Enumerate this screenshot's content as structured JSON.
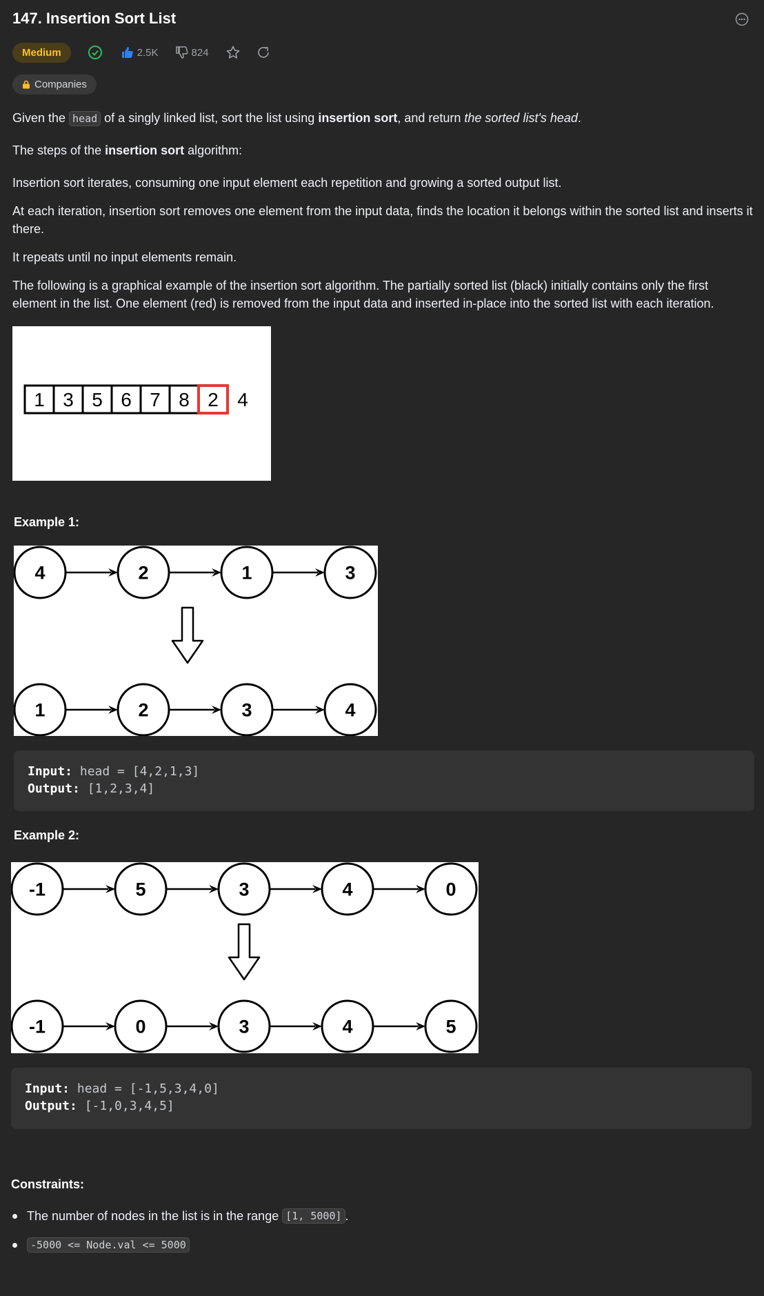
{
  "header": {
    "title": "147. Insertion Sort List",
    "difficulty": "Medium",
    "likes": "2.5K",
    "dislikes": "824",
    "companies_label": "Companies"
  },
  "description": {
    "p1": {
      "a": "Given the ",
      "code": "head",
      "b": " of a singly linked list, sort the list using ",
      "bold": "insertion sort",
      "c": ", and return ",
      "italic": "the sorted list's head",
      "d": "."
    },
    "p2": {
      "a": "The steps of the ",
      "bold": "insertion sort",
      "b": " algorithm:"
    },
    "p3": "Insertion sort iterates, consuming one input element each repetition and growing a sorted output list.",
    "p4": "At each iteration, insertion sort removes one element from the input data, finds the location it belongs within the sorted list and inserts it there.",
    "p5": "It repeats until no input elements remain.",
    "p6": "The following is a graphical example of the insertion sort algorithm. The partially sorted list (black) initially contains only the first element in the list. One element (red) is removed from the input data and inserted in-place into the sorted list with each iteration."
  },
  "animation": {
    "boxes": [
      "1",
      "3",
      "5",
      "6",
      "7",
      "8",
      "2"
    ],
    "trailing": "4"
  },
  "example1": {
    "heading": "Example 1:",
    "before": [
      "4",
      "2",
      "1",
      "3"
    ],
    "after": [
      "1",
      "2",
      "3",
      "4"
    ],
    "input_label": "Input:",
    "input_value": "head = [4,2,1,3]",
    "output_label": "Output:",
    "output_value": "[1,2,3,4]"
  },
  "example2": {
    "heading": "Example 2:",
    "before": [
      "-1",
      "5",
      "3",
      "4",
      "0"
    ],
    "after": [
      "-1",
      "0",
      "3",
      "4",
      "5"
    ],
    "input_label": "Input:",
    "input_value": "head = [-1,5,3,4,0]",
    "output_label": "Output:",
    "output_value": "[-1,0,3,4,5]"
  },
  "constraints": {
    "heading": "Constraints:",
    "c1_text": "The number of nodes in the list is in the range ",
    "c1_code": "[1, 5000]",
    "c1_end": ".",
    "c2_code": "-5000 <= Node.val <= 5000"
  },
  "colors": {
    "accent_like": "#2f80ed",
    "medium": "#ffc01e",
    "solved": "#2cbb5d",
    "highlight": "#e53935"
  }
}
